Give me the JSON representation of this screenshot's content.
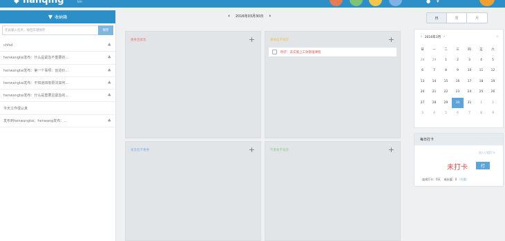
{
  "brand": {
    "name": "hanqing",
    "sub": "tm"
  },
  "sidebar": {
    "title": "收纳箱",
    "placeholder": "在此输入任务，按回车键保存",
    "add_label": "保存",
    "items": [
      {
        "label": "chfsd"
      },
      {
        "label": "henwangtai发布：什么是紧急不重要的..."
      },
      {
        "label": "henwangtai发布：第一个事项：创造价..."
      },
      {
        "label": "henwangtai发布：不知道四象限法如何..."
      },
      {
        "label": "henwangtai发布：什么是重要且紧急的..."
      },
      {
        "label": "今天工作很认真"
      },
      {
        "label": "发布到henwangtai：henwang发布：..."
      }
    ]
  },
  "date_nav": {
    "prev": "‹",
    "date": "2016年03月30日",
    "next": "›"
  },
  "views": {
    "day": "日",
    "week": "周",
    "month": "月"
  },
  "quadrants": [
    {
      "title": "重要且紧急",
      "color": "#e9777a"
    },
    {
      "title": "重要但不紧急",
      "color": "#f0c050",
      "tasks": [
        {
          "label": "例子：去实施上工效管理课程"
        }
      ]
    },
    {
      "title": "紧急但不重要",
      "color": "#7fb3e6"
    },
    {
      "title": "不重要不紧急",
      "color": "#8fce8f"
    }
  ],
  "calendar": {
    "title": "2016年3月",
    "prev": "‹",
    "next": "›",
    "weekdays": [
      "日",
      "一",
      "二",
      "三",
      "四",
      "五",
      "六"
    ],
    "days": [
      "28",
      "29",
      "1",
      "2",
      "3",
      "4",
      "5",
      "6",
      "7",
      "8",
      "9",
      "10",
      "11",
      "12",
      "13",
      "14",
      "15",
      "16",
      "17",
      "18",
      "19",
      "20",
      "21",
      "22",
      "23",
      "24",
      "25",
      "26",
      "27",
      "28",
      "29",
      "30",
      "31",
      "1",
      "2",
      "3",
      "4",
      "5",
      "6",
      "7",
      "8",
      "9"
    ],
    "today": "30"
  },
  "checkin": {
    "title": "每日打卡",
    "link": "加入小组打卡",
    "status": "未打卡",
    "button": "打",
    "stat1": "连续打卡：0天",
    "stat2": "成长值：0",
    "stat2_link": "（兑换）"
  },
  "colors": {
    "primary": "#2c8fc8",
    "accent": "#5da5d9",
    "danger": "#e04848"
  }
}
